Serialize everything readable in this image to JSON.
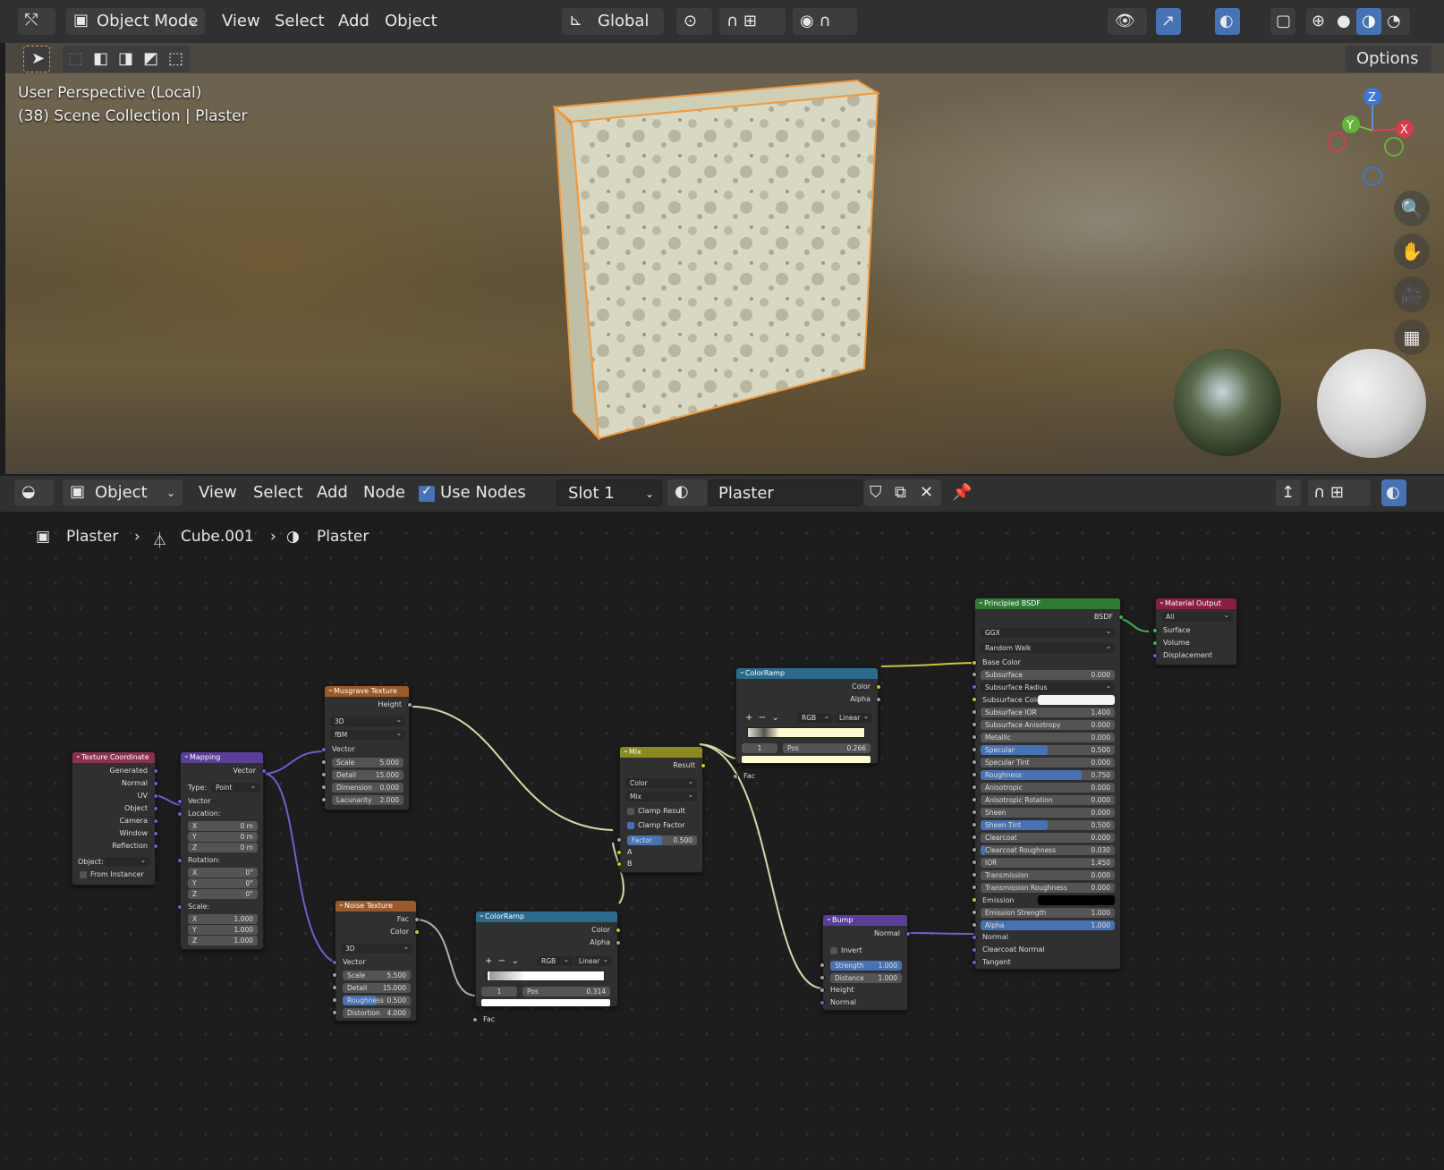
{
  "viewport_header": {
    "mode": "Object Mode",
    "menus": [
      "View",
      "Select",
      "Add",
      "Object"
    ],
    "orientation": "Global",
    "options": "Options"
  },
  "viewport": {
    "line1": "User Perspective (Local)",
    "line2": "(38) Scene Collection | Plaster",
    "axes": {
      "x": "X",
      "y": "Y",
      "z": "Z"
    }
  },
  "node_header": {
    "mode": "Object",
    "menus": [
      "View",
      "Select",
      "Add",
      "Node"
    ],
    "use_nodes": "Use Nodes",
    "slot": "Slot 1",
    "material": "Plaster"
  },
  "breadcrumb": {
    "object": "Plaster",
    "mesh": "Cube.001",
    "material": "Plaster"
  },
  "nodes": {
    "texcoord": {
      "title": "Texture Coordinate",
      "outputs": [
        "Generated",
        "Normal",
        "UV",
        "Object",
        "Camera",
        "Window",
        "Reflection"
      ],
      "object_label": "Object:",
      "from_instancer": "From Instancer"
    },
    "mapping": {
      "title": "Mapping",
      "out": "Vector",
      "type_label": "Type:",
      "type": "Point",
      "vector": "Vector",
      "location": "Location:",
      "rotation": "Rotation:",
      "scale": "Scale:",
      "loc": [
        [
          "X",
          "0 m"
        ],
        [
          "Y",
          "0 m"
        ],
        [
          "Z",
          "0 m"
        ]
      ],
      "rot": [
        [
          "X",
          "0°"
        ],
        [
          "Y",
          "0°"
        ],
        [
          "Z",
          "0°"
        ]
      ],
      "scl": [
        [
          "X",
          "1.000"
        ],
        [
          "Y",
          "1.000"
        ],
        [
          "Z",
          "1.000"
        ]
      ]
    },
    "musgrave": {
      "title": "Musgrave Texture",
      "out": "Height",
      "dim": "3D",
      "type": "fBM",
      "vector": "Vector",
      "fields": [
        [
          "Scale",
          "5.000"
        ],
        [
          "Detail",
          "15.000"
        ],
        [
          "Dimension",
          "0.000"
        ],
        [
          "Lacunarity",
          "2.000"
        ]
      ]
    },
    "noise": {
      "title": "Noise Texture",
      "out1": "Fac",
      "out2": "Color",
      "dim": "3D",
      "vector": "Vector",
      "fields": [
        [
          "Scale",
          "5.500"
        ],
        [
          "Detail",
          "15.000"
        ],
        [
          "Roughness",
          "0.500"
        ],
        [
          "Distortion",
          "4.000"
        ]
      ]
    },
    "ramp1": {
      "title": "ColorRamp",
      "out1": "Color",
      "out2": "Alpha",
      "mode": "RGB",
      "interp": "Linear",
      "idx": "1",
      "pos_label": "Pos",
      "pos": "0.314",
      "in": "Fac"
    },
    "mix": {
      "title": "Mix",
      "out": "Result",
      "dtype": "Color",
      "blend": "Mix",
      "clamp_result": "Clamp Result",
      "clamp_factor": "Clamp Factor",
      "factor_label": "Factor",
      "factor": "0.500",
      "a": "A",
      "b": "B"
    },
    "ramp2": {
      "title": "ColorRamp",
      "out1": "Color",
      "out2": "Alpha",
      "mode": "RGB",
      "interp": "Linear",
      "idx": "1",
      "pos_label": "Pos",
      "pos": "0.266",
      "in": "Fac"
    },
    "bump": {
      "title": "Bump",
      "out": "Normal",
      "invert": "Invert",
      "fields": [
        [
          "Strength",
          "1.000"
        ],
        [
          "Distance",
          "1.000"
        ]
      ],
      "height": "Height",
      "normal": "Normal"
    },
    "bsdf": {
      "title": "Principled BSDF",
      "out": "BSDF",
      "dist": "GGX",
      "sss": "Random Walk",
      "base_color": "Base Color",
      "fields": [
        [
          "Subsurface",
          "0.000",
          0
        ],
        [
          "Subsurface Radius",
          "",
          0
        ],
        [
          "Subsurface Color",
          "",
          0
        ],
        [
          "Subsurface IOR",
          "1.400",
          0
        ],
        [
          "Subsurface Anisotropy",
          "0.000",
          0
        ],
        [
          "Metallic",
          "0.000",
          0
        ],
        [
          "Specular",
          "0.500",
          0.5
        ],
        [
          "Specular Tint",
          "0.000",
          0
        ],
        [
          "Roughness",
          "0.750",
          0.75
        ],
        [
          "Anisotropic",
          "0.000",
          0
        ],
        [
          "Anisotropic Rotation",
          "0.000",
          0
        ],
        [
          "Sheen",
          "0.000",
          0
        ],
        [
          "Sheen Tint",
          "0.500",
          0.5
        ],
        [
          "Clearcoat",
          "0.000",
          0
        ],
        [
          "Clearcoat Roughness",
          "0.030",
          0.03
        ],
        [
          "IOR",
          "1.450",
          0
        ],
        [
          "Transmission",
          "0.000",
          0
        ],
        [
          "Transmission Roughness",
          "0.000",
          0
        ],
        [
          "Emission",
          "",
          0
        ],
        [
          "Emission Strength",
          "1.000",
          0
        ],
        [
          "Alpha",
          "1.000",
          1
        ]
      ],
      "tail": [
        "Normal",
        "Clearcoat Normal",
        "Tangent"
      ]
    },
    "output": {
      "title": "Material Output",
      "target": "All",
      "inputs": [
        "Surface",
        "Volume",
        "Displacement"
      ]
    }
  },
  "colors": {
    "accent": "#4772b3",
    "select_outline": "#f39a3d",
    "header_input": "#8a3050",
    "header_vector": "#5a3f9a",
    "header_texture": "#9a5a2a",
    "header_converter": "#2b6a8a",
    "header_shader": "#2f7a35",
    "header_output": "#8a2040",
    "header_mix": "#8a8a20"
  }
}
